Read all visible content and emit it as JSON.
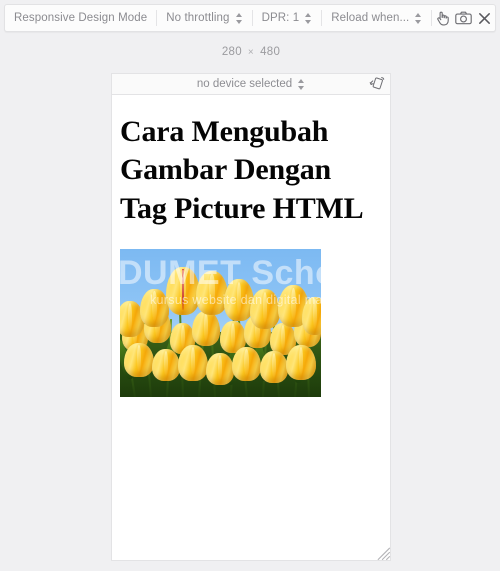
{
  "toolbar": {
    "mode_label": "Responsive Design Mode",
    "throttling": {
      "label": "No throttling",
      "icon": "updown-spinner-icon"
    },
    "dpr": {
      "label": "DPR: 1",
      "icon": "updown-spinner-icon"
    },
    "reload_conditions": {
      "label": "Reload when...",
      "icon": "updown-spinner-icon"
    },
    "icons": {
      "touch_simulation": "touch-hand-icon",
      "screenshot": "camera-icon",
      "close": "close-icon"
    }
  },
  "viewport": {
    "width": "280",
    "separator": "×",
    "height": "480",
    "device_selector_label": "no device selected",
    "rotate_icon": "rotate-viewport-icon",
    "resize_grip_icon": "resize-grip-icon"
  },
  "page": {
    "heading": "Cara Mengubah Gambar Dengan Tag Picture HTML",
    "figure": {
      "alt": "yellow tulips against blue sky",
      "watermark_title": "DUMET School",
      "watermark_subtitle": "kursus website dan digital marketing"
    }
  },
  "colors": {
    "app_background": "#f0f0f2",
    "toolbar_background": "#fcfcfc",
    "toolbar_text": "#8b8b90",
    "viewport_background": "#ffffff",
    "viewport_border": "#e3e3e5",
    "heading_text": "#050505"
  }
}
